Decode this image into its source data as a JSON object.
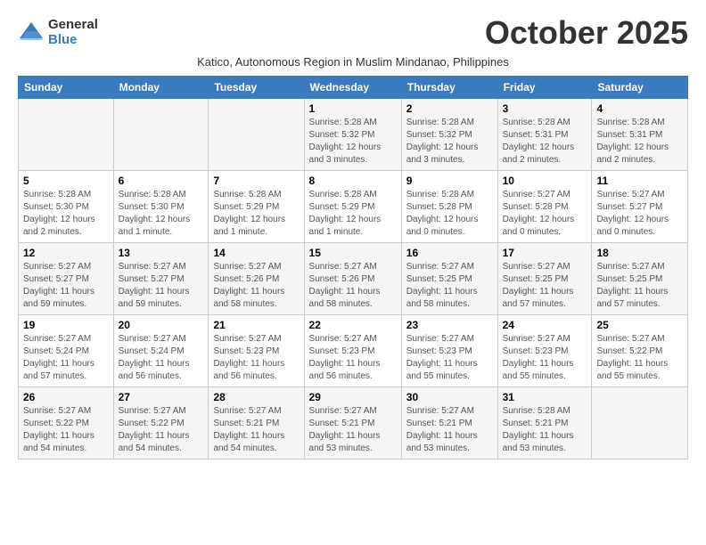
{
  "logo": {
    "general": "General",
    "blue": "Blue"
  },
  "title": "October 2025",
  "subtitle": "Katico, Autonomous Region in Muslim Mindanao, Philippines",
  "weekdays": [
    "Sunday",
    "Monday",
    "Tuesday",
    "Wednesday",
    "Thursday",
    "Friday",
    "Saturday"
  ],
  "weeks": [
    [
      {
        "day": "",
        "info": ""
      },
      {
        "day": "",
        "info": ""
      },
      {
        "day": "",
        "info": ""
      },
      {
        "day": "1",
        "info": "Sunrise: 5:28 AM\nSunset: 5:32 PM\nDaylight: 12 hours\nand 3 minutes."
      },
      {
        "day": "2",
        "info": "Sunrise: 5:28 AM\nSunset: 5:32 PM\nDaylight: 12 hours\nand 3 minutes."
      },
      {
        "day": "3",
        "info": "Sunrise: 5:28 AM\nSunset: 5:31 PM\nDaylight: 12 hours\nand 2 minutes."
      },
      {
        "day": "4",
        "info": "Sunrise: 5:28 AM\nSunset: 5:31 PM\nDaylight: 12 hours\nand 2 minutes."
      }
    ],
    [
      {
        "day": "5",
        "info": "Sunrise: 5:28 AM\nSunset: 5:30 PM\nDaylight: 12 hours\nand 2 minutes."
      },
      {
        "day": "6",
        "info": "Sunrise: 5:28 AM\nSunset: 5:30 PM\nDaylight: 12 hours\nand 1 minute."
      },
      {
        "day": "7",
        "info": "Sunrise: 5:28 AM\nSunset: 5:29 PM\nDaylight: 12 hours\nand 1 minute."
      },
      {
        "day": "8",
        "info": "Sunrise: 5:28 AM\nSunset: 5:29 PM\nDaylight: 12 hours\nand 1 minute."
      },
      {
        "day": "9",
        "info": "Sunrise: 5:28 AM\nSunset: 5:28 PM\nDaylight: 12 hours\nand 0 minutes."
      },
      {
        "day": "10",
        "info": "Sunrise: 5:27 AM\nSunset: 5:28 PM\nDaylight: 12 hours\nand 0 minutes."
      },
      {
        "day": "11",
        "info": "Sunrise: 5:27 AM\nSunset: 5:27 PM\nDaylight: 12 hours\nand 0 minutes."
      }
    ],
    [
      {
        "day": "12",
        "info": "Sunrise: 5:27 AM\nSunset: 5:27 PM\nDaylight: 11 hours\nand 59 minutes."
      },
      {
        "day": "13",
        "info": "Sunrise: 5:27 AM\nSunset: 5:27 PM\nDaylight: 11 hours\nand 59 minutes."
      },
      {
        "day": "14",
        "info": "Sunrise: 5:27 AM\nSunset: 5:26 PM\nDaylight: 11 hours\nand 58 minutes."
      },
      {
        "day": "15",
        "info": "Sunrise: 5:27 AM\nSunset: 5:26 PM\nDaylight: 11 hours\nand 58 minutes."
      },
      {
        "day": "16",
        "info": "Sunrise: 5:27 AM\nSunset: 5:25 PM\nDaylight: 11 hours\nand 58 minutes."
      },
      {
        "day": "17",
        "info": "Sunrise: 5:27 AM\nSunset: 5:25 PM\nDaylight: 11 hours\nand 57 minutes."
      },
      {
        "day": "18",
        "info": "Sunrise: 5:27 AM\nSunset: 5:25 PM\nDaylight: 11 hours\nand 57 minutes."
      }
    ],
    [
      {
        "day": "19",
        "info": "Sunrise: 5:27 AM\nSunset: 5:24 PM\nDaylight: 11 hours\nand 57 minutes."
      },
      {
        "day": "20",
        "info": "Sunrise: 5:27 AM\nSunset: 5:24 PM\nDaylight: 11 hours\nand 56 minutes."
      },
      {
        "day": "21",
        "info": "Sunrise: 5:27 AM\nSunset: 5:23 PM\nDaylight: 11 hours\nand 56 minutes."
      },
      {
        "day": "22",
        "info": "Sunrise: 5:27 AM\nSunset: 5:23 PM\nDaylight: 11 hours\nand 56 minutes."
      },
      {
        "day": "23",
        "info": "Sunrise: 5:27 AM\nSunset: 5:23 PM\nDaylight: 11 hours\nand 55 minutes."
      },
      {
        "day": "24",
        "info": "Sunrise: 5:27 AM\nSunset: 5:23 PM\nDaylight: 11 hours\nand 55 minutes."
      },
      {
        "day": "25",
        "info": "Sunrise: 5:27 AM\nSunset: 5:22 PM\nDaylight: 11 hours\nand 55 minutes."
      }
    ],
    [
      {
        "day": "26",
        "info": "Sunrise: 5:27 AM\nSunset: 5:22 PM\nDaylight: 11 hours\nand 54 minutes."
      },
      {
        "day": "27",
        "info": "Sunrise: 5:27 AM\nSunset: 5:22 PM\nDaylight: 11 hours\nand 54 minutes."
      },
      {
        "day": "28",
        "info": "Sunrise: 5:27 AM\nSunset: 5:21 PM\nDaylight: 11 hours\nand 54 minutes."
      },
      {
        "day": "29",
        "info": "Sunrise: 5:27 AM\nSunset: 5:21 PM\nDaylight: 11 hours\nand 53 minutes."
      },
      {
        "day": "30",
        "info": "Sunrise: 5:27 AM\nSunset: 5:21 PM\nDaylight: 11 hours\nand 53 minutes."
      },
      {
        "day": "31",
        "info": "Sunrise: 5:28 AM\nSunset: 5:21 PM\nDaylight: 11 hours\nand 53 minutes."
      },
      {
        "day": "",
        "info": ""
      }
    ]
  ]
}
